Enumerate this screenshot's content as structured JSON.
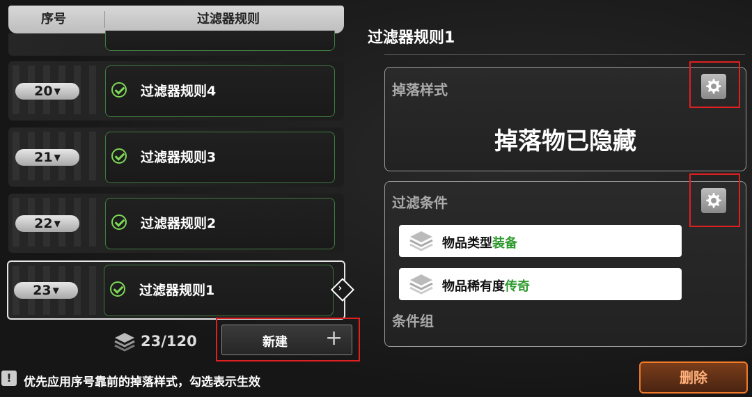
{
  "list": {
    "header_index": "序号",
    "header_rule": "过滤器规则",
    "rows": [
      {
        "number": "20",
        "name": "过滤器规则4"
      },
      {
        "number": "21",
        "name": "过滤器规则3"
      },
      {
        "number": "22",
        "name": "过滤器规则2"
      },
      {
        "number": "23",
        "name": "过滤器规则1"
      }
    ],
    "count": "23/120",
    "new_button": "新建"
  },
  "hint": {
    "icon": "!",
    "text": "优先应用序号靠前的掉落样式，勾选表示生效"
  },
  "detail": {
    "title": "过滤器规则1",
    "drop_style_label": "掉落样式",
    "drop_style_value": "掉落物已隐藏",
    "filter_label": "过滤条件",
    "conditions": [
      {
        "label": "物品类型",
        "value": "装备"
      },
      {
        "label": "物品稀有度",
        "value": "传奇"
      }
    ],
    "group_label": "条件组",
    "delete_button": "删除"
  },
  "icons": {
    "checkmark": "check-circle-icon",
    "dropdown": "triangle-down-icon",
    "settings": "gear-icon",
    "layers": "layers-icon",
    "plus": "plus-icon",
    "arrow": "chevron-right-icon",
    "warning": "exclamation-icon"
  },
  "colors": {
    "accent_green": "#7ed957",
    "value_green": "#2e9a2e",
    "highlight_red": "#e02020",
    "delete_orange": "#f07a2a"
  }
}
